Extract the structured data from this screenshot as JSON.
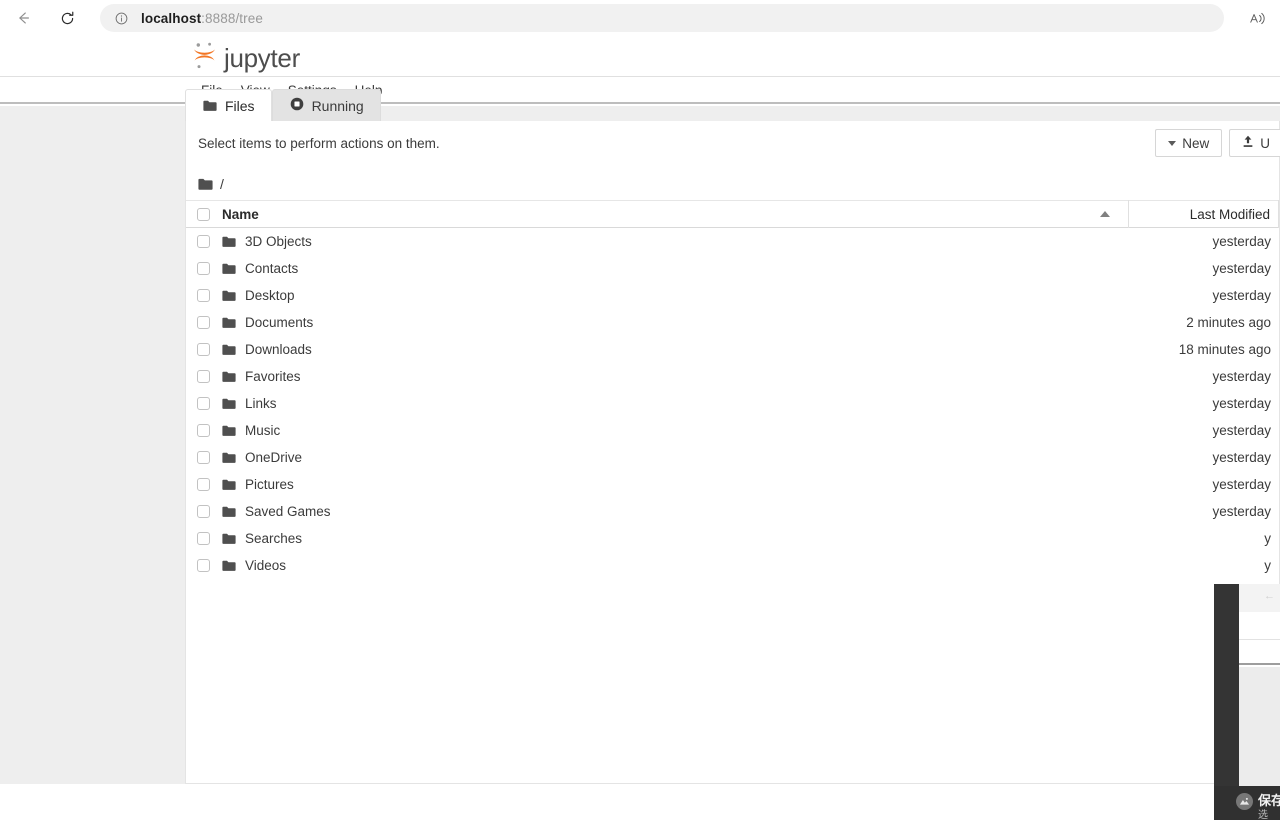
{
  "browser": {
    "back_label": "Back",
    "reload_label": "Refresh",
    "site_info_label": "View site information",
    "url_host": "localhost",
    "url_rest": ":8888/tree",
    "read_aloud_label": "Read aloud"
  },
  "app": {
    "brand": "jupyter",
    "menu": [
      {
        "label": "File"
      },
      {
        "label": "View"
      },
      {
        "label": "Settings"
      },
      {
        "label": "Help"
      }
    ],
    "tabs": [
      {
        "label": "Files",
        "icon": "folder-icon",
        "active": true
      },
      {
        "label": "Running",
        "icon": "circle-stop-icon",
        "active": false
      }
    ]
  },
  "toolbar": {
    "select_hint": "Select items to perform actions on them.",
    "new_label": "New",
    "upload_label": "U"
  },
  "breadcrumb": {
    "icon": "folder-icon",
    "path": "/"
  },
  "table": {
    "columns": {
      "name": "Name",
      "last_modified": "Last Modified"
    },
    "sort": "ascending",
    "rows": [
      {
        "name": "3D Objects",
        "modified": "yesterday"
      },
      {
        "name": "Contacts",
        "modified": "yesterday"
      },
      {
        "name": "Desktop",
        "modified": "yesterday"
      },
      {
        "name": "Documents",
        "modified": "2 minutes ago"
      },
      {
        "name": "Downloads",
        "modified": "18 minutes ago"
      },
      {
        "name": "Favorites",
        "modified": "yesterday"
      },
      {
        "name": "Links",
        "modified": "yesterday"
      },
      {
        "name": "Music",
        "modified": "yesterday"
      },
      {
        "name": "OneDrive",
        "modified": "yesterday"
      },
      {
        "name": "Pictures",
        "modified": "yesterday"
      },
      {
        "name": "Saved Games",
        "modified": "yesterday"
      },
      {
        "name": "Searches",
        "modified": "y"
      },
      {
        "name": "Videos",
        "modified": "y"
      }
    ]
  },
  "overlay": {
    "back_glyph": "←",
    "taskbar_title": "保存",
    "taskbar_sub": "选"
  },
  "colors": {
    "brand_orange": "#f37726",
    "page_background": "#eeeeee",
    "panel_background": "#ffffff",
    "text_primary": "#3b3b3b"
  }
}
